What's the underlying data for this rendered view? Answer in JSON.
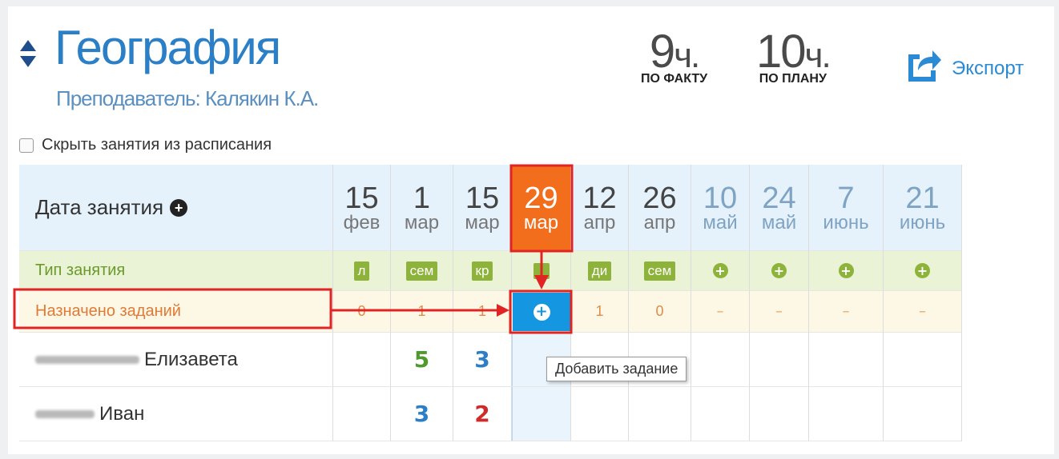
{
  "header": {
    "subject": "География",
    "teacher": "Преподаватель: Калякин К.А.",
    "fact_hours": "9",
    "fact_unit": "ч.",
    "fact_caption": "ПО ФАКТУ",
    "plan_hours": "10",
    "plan_unit": "ч.",
    "plan_caption": "ПО ПЛАНУ",
    "export_label": "Экспорт"
  },
  "filter": {
    "hide_schedule_label": "Скрыть занятия из расписания",
    "checked": false
  },
  "table": {
    "date_header_label": "Дата занятия",
    "type_row_label": "Тип занятия",
    "assign_row_label": "Назначено заданий",
    "dates": [
      {
        "day": "15",
        "month": "фев",
        "type": "л",
        "assigned": "0"
      },
      {
        "day": "1",
        "month": "мар",
        "type": "сем",
        "assigned": "1"
      },
      {
        "day": "15",
        "month": "мар",
        "type": "кр",
        "assigned": "1"
      },
      {
        "day": "29",
        "month": "мар",
        "type": "",
        "assigned": "+"
      },
      {
        "day": "12",
        "month": "апр",
        "type": "ди",
        "assigned": "1"
      },
      {
        "day": "26",
        "month": "апр",
        "type": "сем",
        "assigned": "0"
      },
      {
        "day": "10",
        "month": "май",
        "type": "+",
        "assigned": "–"
      },
      {
        "day": "24",
        "month": "май",
        "type": "+",
        "assigned": "–"
      },
      {
        "day": "7",
        "month": "июнь",
        "type": "+",
        "assigned": "–"
      },
      {
        "day": "21",
        "month": "июнь",
        "type": "+",
        "assigned": "–"
      }
    ],
    "students": [
      {
        "name": "Елизавета",
        "grades": [
          "",
          "5",
          "3",
          "",
          "",
          "",
          "",
          "",
          "",
          ""
        ]
      },
      {
        "name": "Иван",
        "grades": [
          "",
          "3",
          "2",
          "",
          "",
          "",
          "",
          "",
          "",
          ""
        ]
      }
    ]
  },
  "tooltip": "Добавить задание",
  "colors": {
    "accent_blue": "#2a7fc7",
    "active_orange": "#f26d1c",
    "type_green": "#8db33b",
    "annotation_red": "#e02424"
  }
}
